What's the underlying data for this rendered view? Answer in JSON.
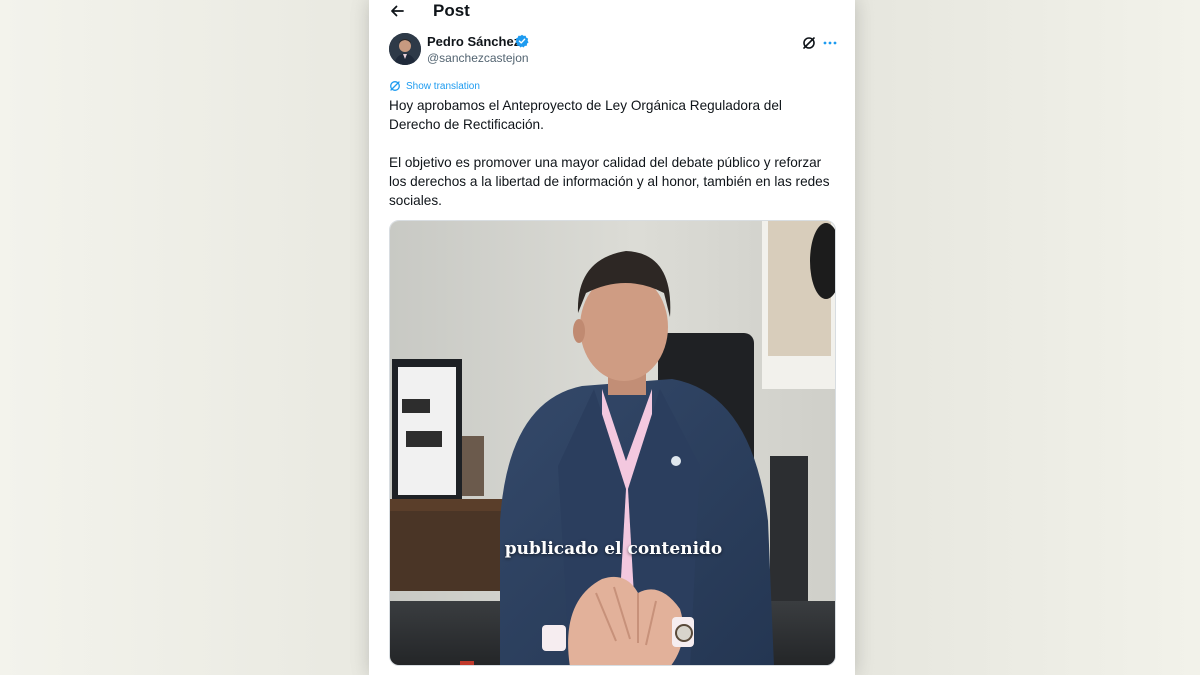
{
  "header": {
    "title": "Post"
  },
  "author": {
    "name": "Pedro Sánchez",
    "handle": "@sanchezcastejon"
  },
  "translation": {
    "label": "Show translation"
  },
  "tweet": {
    "paragraph_1": "Hoy aprobamos el Anteproyecto de Ley Orgánica Reguladora del\nDerecho de Rectificación.",
    "paragraph_2": "El objetivo es promover una mayor calidad del debate público y reforzar\nlos derechos a la libertad de información y al honor, también en las redes\nsociales."
  },
  "media": {
    "caption": "publicado el contenido"
  },
  "colors": {
    "accent": "#1d9bf0",
    "text_primary": "#0f1419",
    "text_secondary": "#536471"
  },
  "icons": {
    "back": "arrow-left-icon",
    "verified": "verified-badge-icon",
    "grok": "grok-icon",
    "more": "more-options-icon",
    "translate": "translate-icon"
  }
}
